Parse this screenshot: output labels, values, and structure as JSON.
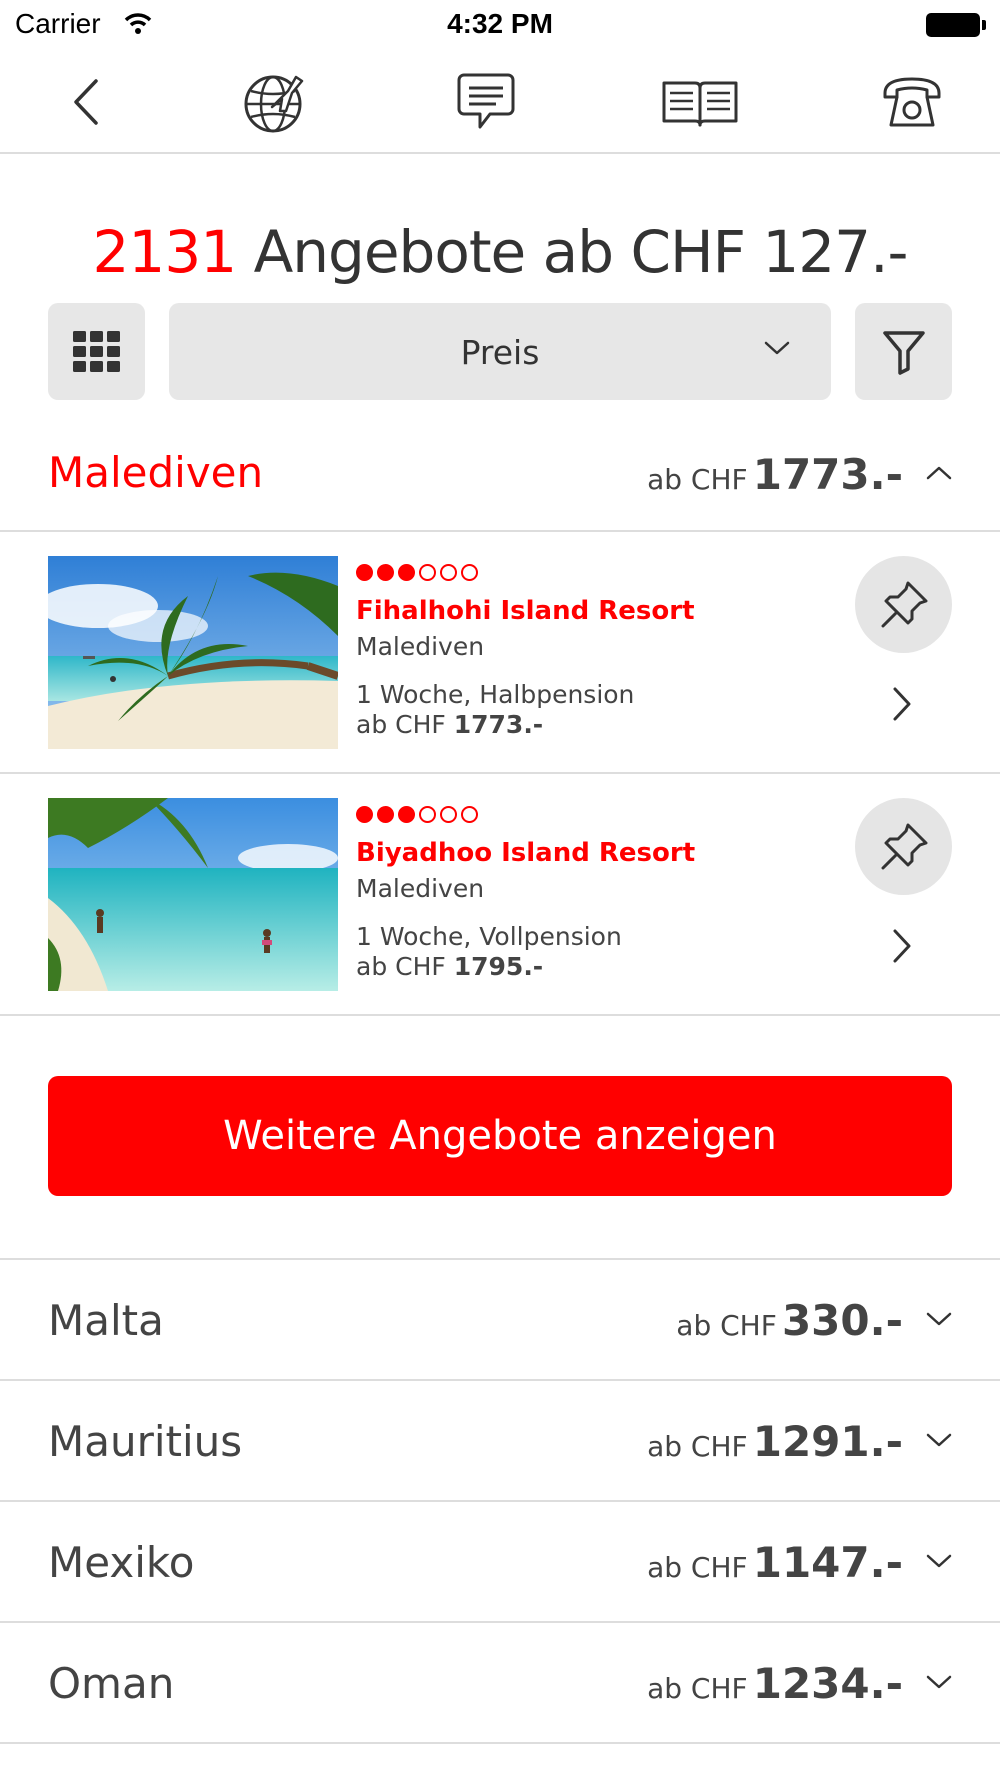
{
  "status_bar": {
    "carrier": "Carrier",
    "time": "4:32 PM"
  },
  "nav": {
    "icons": [
      "back-icon",
      "globe-plane-icon",
      "chat-icon",
      "catalog-book-icon",
      "phone-icon"
    ]
  },
  "headline": {
    "count": "2131",
    "text": "Angebote ab CHF 127.-"
  },
  "toolbar": {
    "sort_label": "Preis"
  },
  "expanded_country": {
    "name": "Malediven",
    "price_prefix": "ab CHF",
    "price": "1773.-"
  },
  "offers": [
    {
      "rating_full": 3,
      "rating_total": 6,
      "name": "Fihalhohi Island Resort",
      "country": "Malediven",
      "board": "1 Woche, Halbpension",
      "price_prefix": "ab CHF",
      "price": "1773.-"
    },
    {
      "rating_full": 3,
      "rating_total": 6,
      "name": "Biyadhoo Island Resort",
      "country": "Malediven",
      "board": "1 Woche, Vollpension",
      "price_prefix": "ab CHF",
      "price": "1795.-"
    }
  ],
  "more_button": "Weitere Angebote anzeigen",
  "countries": [
    {
      "name": "Malta",
      "price_prefix": "ab CHF",
      "price": "330.-"
    },
    {
      "name": "Mauritius",
      "price_prefix": "ab CHF",
      "price": "1291.-"
    },
    {
      "name": "Mexiko",
      "price_prefix": "ab CHF",
      "price": "1147.-"
    },
    {
      "name": "Oman",
      "price_prefix": "ab CHF",
      "price": "1234.-"
    }
  ],
  "colors": {
    "accent": "#ff0000",
    "button_bg": "#e7e7e7",
    "divider": "#dddddd"
  }
}
